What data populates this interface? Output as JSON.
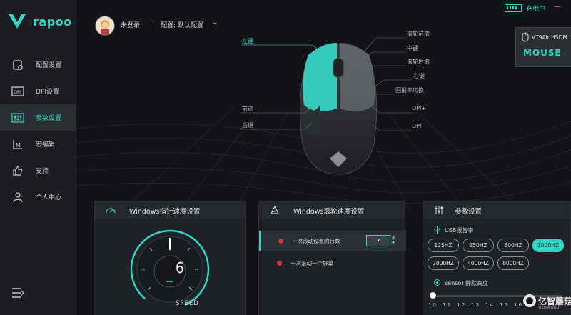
{
  "app": {
    "logo_text": "rapoo"
  },
  "sidebar": {
    "items": [
      {
        "label": "配置设置",
        "icon": "config-settings-icon"
      },
      {
        "label": "DPI设置",
        "icon": "dpi-icon"
      },
      {
        "label": "参数设置",
        "icon": "parameter-settings-icon",
        "active": true
      },
      {
        "label": "宏编辑",
        "icon": "macro-icon"
      },
      {
        "label": "支持",
        "icon": "thumbs-up-icon"
      },
      {
        "label": "个人中心",
        "icon": "user-icon"
      }
    ],
    "menu_icon": "menu-icon"
  },
  "header": {
    "login_status": "未登录",
    "separator": "|",
    "config_label": "配置: 默认配置",
    "charging": "充电中",
    "minimize": "—"
  },
  "device": {
    "name": "VT9Air HSDM",
    "type": "MOUSE"
  },
  "mouse_labels": {
    "left_button": "左键",
    "scroll_forward": "滚轮前滚",
    "middle_button": "中键",
    "scroll_backward": "滚轮后滚",
    "right_button": "右键",
    "polling_switch": "回报率切换",
    "forward": "前进",
    "back": "后退",
    "dpi_plus": "DPI+",
    "dpi_minus": "DPI-"
  },
  "pointer_panel": {
    "title": "Windows指针速度设置",
    "speed_value": "6",
    "speed_label": "SPEED"
  },
  "scroll_panel": {
    "title": "Windows滚轮速度设置",
    "option1": "一次滚动设置的行数",
    "option1_value": "7",
    "option2": "一次滚动一个屏幕"
  },
  "param_panel": {
    "title": "参数设置",
    "usb_label": "USB报告率",
    "rates": [
      "125HZ",
      "250HZ",
      "500HZ",
      "1000HZ",
      "2000HZ",
      "4000HZ",
      "8000HZ"
    ],
    "selected_rate": "1000HZ",
    "sensor_label": "sensor 静默高度",
    "ticks": [
      "1.0",
      "1.1",
      "1.2",
      "1.3",
      "1.4",
      "1.5",
      "1.6"
    ],
    "slider_value": 1.0
  },
  "watermark": {
    "text": "亿智蘑菇",
    "sub": "YIZHIMOGU"
  },
  "colors": {
    "accent": "#2fd6c6",
    "background": "#14161a",
    "panel": "#1e2126",
    "dot": "#d0353a"
  }
}
